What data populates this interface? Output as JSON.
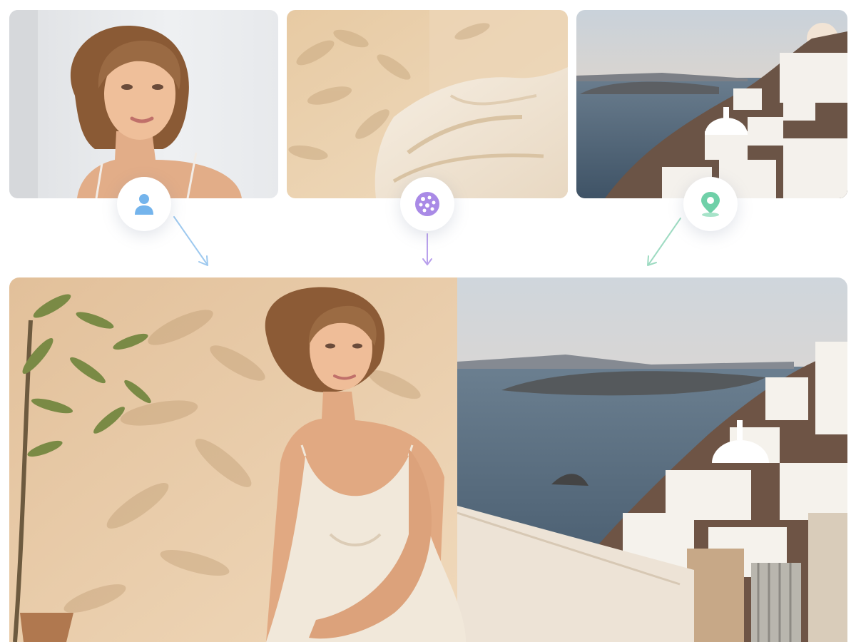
{
  "inputs": [
    {
      "kind": "subject",
      "icon": "person-icon",
      "accent": "#74b4ec"
    },
    {
      "kind": "style",
      "icon": "palette-icon",
      "accent": "#a98ae6"
    },
    {
      "kind": "location",
      "icon": "map-pin-icon",
      "accent": "#6fd0a8"
    }
  ],
  "colors": {
    "subject_arrow": "#9ec9ef",
    "style_arrow": "#b9a0ec",
    "location_arrow": "#9edbc2",
    "sunset_sky_top": "#cfd6dc",
    "sunset_sky_bottom": "#f3d7bf",
    "sea": "#4e6377",
    "plaster": "#e9d1b1",
    "linen": "#f1e8da"
  }
}
